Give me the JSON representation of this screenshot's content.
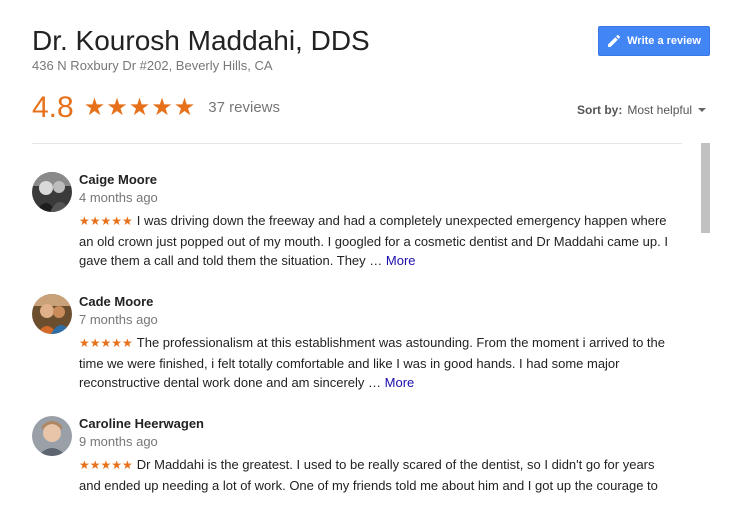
{
  "business": {
    "name": "Dr. Kourosh Maddahi, DDS",
    "address": "436 N Roxbury Dr #202, Beverly Hills, CA"
  },
  "write_review": {
    "label": "Write a review",
    "icon": "pencil-icon"
  },
  "rating": {
    "value": "4.8",
    "stars": "★★★★★",
    "count_label": "37 reviews"
  },
  "sort": {
    "label": "Sort by:",
    "value": "Most helpful"
  },
  "reviews": [
    {
      "name": "Caige Moore",
      "time": "4 months ago",
      "stars": "★★★★★",
      "text": "I was driving down the freeway and had a completely unexpected emergency happen where an old crown just popped out of my mouth. I googled for a cosmetic dentist and Dr Maddahi came up. I gave them a call and told them the situation. They …",
      "more": "More"
    },
    {
      "name": "Cade Moore",
      "time": "7 months ago",
      "stars": "★★★★★",
      "text": "The professionalism at this establishment was astounding. From the moment i arrived to the time we were finished, i felt totally comfortable and like I was in good hands. I had some major reconstructive dental work done and am sincerely …",
      "more": "More"
    },
    {
      "name": "Caroline Heerwagen",
      "time": "9 months ago",
      "stars": "★★★★★",
      "text": "Dr Maddahi is the greatest. I used to be really scared of the dentist, so I didn't go for years and ended up needing a lot of work. One of my friends told me about him and I got up the courage to",
      "more": ""
    }
  ],
  "colors": {
    "accent_orange": "#e7711b",
    "button_blue": "#4285f4",
    "link_blue": "#1a0dab",
    "muted_gray": "#777777"
  }
}
